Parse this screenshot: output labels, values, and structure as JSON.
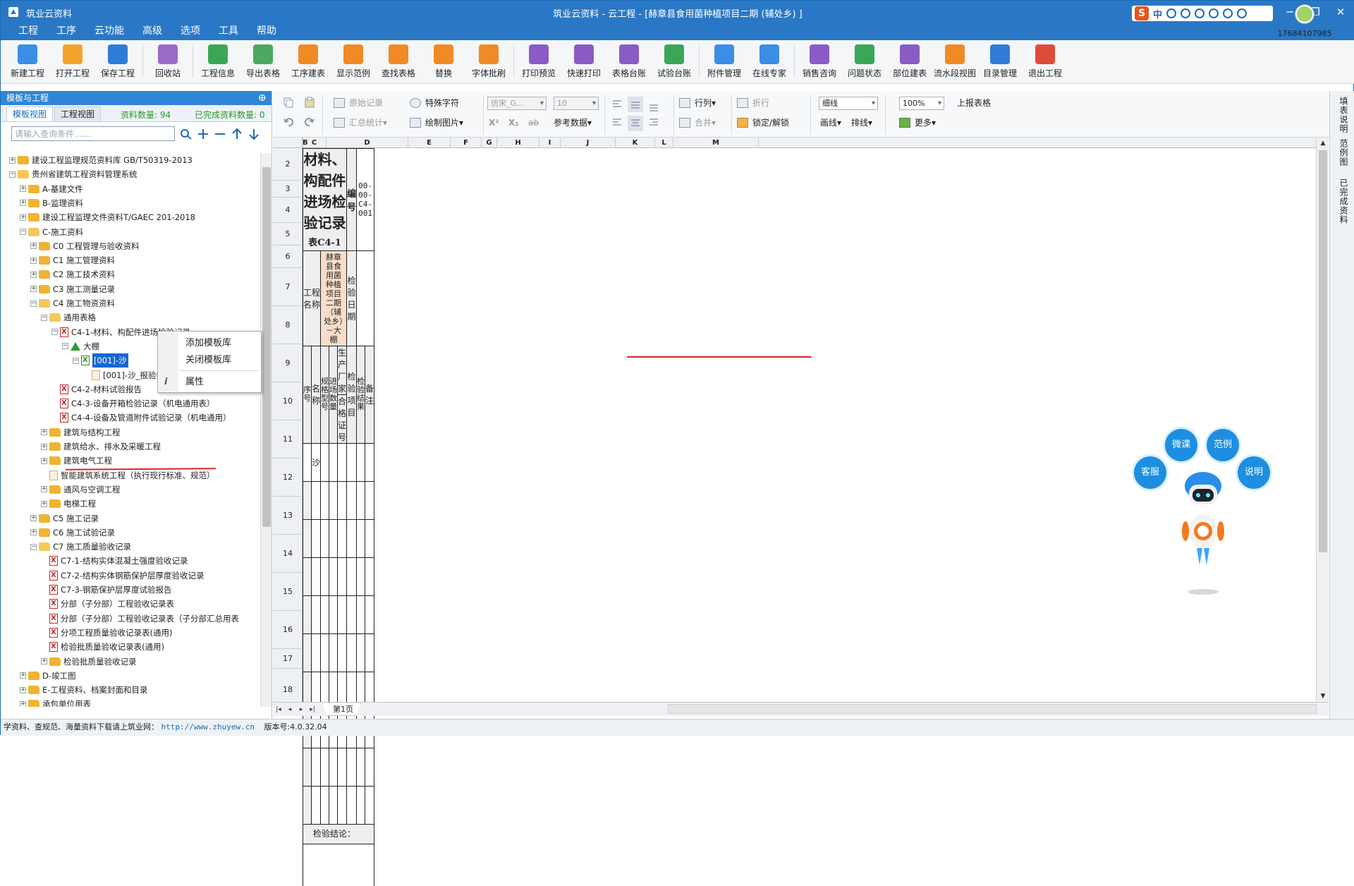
{
  "titlebar": {
    "app_name": "筑业云资料",
    "window_title": "筑业云资料 - 云工程 - [赫章县食用菌种植项目二期 (辅处乡) ]",
    "ime_label": "中",
    "ime_logo": "S",
    "min": "─",
    "max": "❐",
    "close": "✕"
  },
  "menu": [
    "工程",
    "工序",
    "云功能",
    "高级",
    "选项",
    "工具",
    "帮助"
  ],
  "toolbar": {
    "buttons": [
      {
        "label": "新建工程",
        "icon": "new-project-icon",
        "color": "#3a8ee6"
      },
      {
        "label": "打开工程",
        "icon": "open-folder-icon",
        "color": "#f2a42a"
      },
      {
        "label": "保存工程",
        "icon": "save-icon",
        "color": "#2f7cd8"
      },
      {
        "label": "回收站",
        "icon": "recycle-bin-icon",
        "color": "#9b6bc9"
      },
      {
        "label": "工程信息",
        "icon": "info-icon",
        "color": "#3aa757"
      },
      {
        "label": "导出表格",
        "icon": "export-table-icon",
        "color": "#4aa860"
      },
      {
        "label": "工序建表",
        "icon": "layers-icon",
        "color": "#f08a24"
      },
      {
        "label": "显示范例",
        "icon": "example-icon",
        "color": "#f08a24"
      },
      {
        "label": "查找表格",
        "icon": "search-table-icon",
        "color": "#f08a24"
      },
      {
        "label": "替换",
        "icon": "replace-icon",
        "color": "#f08a24"
      },
      {
        "label": "字体批刷",
        "icon": "font-brush-icon",
        "color": "#f08a24"
      },
      {
        "label": "打印预览",
        "icon": "print-preview-icon",
        "color": "#8a5bc6"
      },
      {
        "label": "快速打印",
        "icon": "printer-icon",
        "color": "#8a5bc6"
      },
      {
        "label": "表格台账",
        "icon": "ledger-icon",
        "color": "#8a5bc6"
      },
      {
        "label": "试验台账",
        "icon": "test-ledger-icon",
        "color": "#3aa757"
      },
      {
        "label": "附件管理",
        "icon": "attachment-icon",
        "color": "#3a8ee6"
      },
      {
        "label": "在线专家",
        "icon": "expert-icon",
        "color": "#3a8ee6"
      },
      {
        "label": "销售咨询",
        "icon": "consult-icon",
        "color": "#8a5bc6"
      },
      {
        "label": "问题状态",
        "icon": "question-icon",
        "color": "#3aa757"
      },
      {
        "label": "部位建表",
        "icon": "grid-icon",
        "color": "#8a5bc6"
      },
      {
        "label": "流水段视图",
        "icon": "flow-view-icon",
        "color": "#f08a24"
      },
      {
        "label": "目录管理",
        "icon": "catalog-icon",
        "color": "#2f7cd8"
      },
      {
        "label": "退出工程",
        "icon": "power-icon",
        "color": "#e04a3a"
      }
    ],
    "user_id": "17684107985"
  },
  "left_panel": {
    "header": "模板与工程",
    "pin": "ⴲ",
    "tabs": [
      "模板视图",
      "工程视图"
    ],
    "stat_total": "资料数量: 94",
    "stat_done": "已完成资料数量: 0",
    "search_placeholder": "请输入查询条件……",
    "tree": [
      {
        "text": "建设工程监理规范资料库 GB/T50319-2013",
        "level": 0,
        "exp": "+",
        "icon": "folder"
      },
      {
        "text": "贵州省建筑工程资料管理系统",
        "level": 0,
        "exp": "−",
        "icon": "folder-open"
      },
      {
        "text": "A-基建文件",
        "level": 1,
        "exp": "+",
        "icon": "folder"
      },
      {
        "text": "B-监理资料",
        "level": 1,
        "exp": "+",
        "icon": "folder"
      },
      {
        "text": "建设工程监理文件资料T/GAEC 201-2018",
        "level": 1,
        "exp": "+",
        "icon": "folder"
      },
      {
        "text": "C-施工资料",
        "level": 1,
        "exp": "−",
        "icon": "folder-open"
      },
      {
        "text": "C0 工程管理与验收资料",
        "level": 2,
        "exp": "+",
        "icon": "folder"
      },
      {
        "text": "C1 施工管理资料",
        "level": 2,
        "exp": "+",
        "icon": "folder"
      },
      {
        "text": "C2 施工技术资料",
        "level": 2,
        "exp": "+",
        "icon": "folder"
      },
      {
        "text": "C3 施工测量记录",
        "level": 2,
        "exp": "+",
        "icon": "folder"
      },
      {
        "text": "C4 施工物资资料",
        "level": 2,
        "exp": "−",
        "icon": "folder-open"
      },
      {
        "text": "通用表格",
        "level": 3,
        "exp": "−",
        "icon": "folder-open"
      },
      {
        "text": "C4-1-材料、构配件进场检验记录",
        "level": 4,
        "exp": "−",
        "icon": "xl"
      },
      {
        "text": "大棚",
        "level": 5,
        "exp": "−",
        "icon": "home"
      },
      {
        "text": "[001]-沙",
        "level": 6,
        "exp": "−",
        "icon": "xg",
        "selected": true
      },
      {
        "text": "[001]-沙_报验申请表",
        "level": 7,
        "exp": "",
        "icon": "doc"
      },
      {
        "text": "C4-2-材料试验报告",
        "level": 4,
        "exp": "",
        "icon": "xl"
      },
      {
        "text": "C4-3-设备开箱检验记录（机电通用表）",
        "level": 4,
        "exp": "",
        "icon": "xl"
      },
      {
        "text": "C4-4-设备及管道附件试验记录（机电通用）",
        "level": 4,
        "exp": "",
        "icon": "xl"
      },
      {
        "text": "建筑与结构工程",
        "level": 3,
        "exp": "+",
        "icon": "folder"
      },
      {
        "text": "建筑给水、排水及采暖工程",
        "level": 3,
        "exp": "+",
        "icon": "folder"
      },
      {
        "text": "建筑电气工程",
        "level": 3,
        "exp": "+",
        "icon": "folder"
      },
      {
        "text": "智能建筑系统工程（执行现行标准、规范）",
        "level": 3,
        "exp": "",
        "icon": "doc"
      },
      {
        "text": "通风与空调工程",
        "level": 3,
        "exp": "+",
        "icon": "folder"
      },
      {
        "text": "电梯工程",
        "level": 3,
        "exp": "+",
        "icon": "folder"
      },
      {
        "text": "C5 施工记录",
        "level": 2,
        "exp": "+",
        "icon": "folder"
      },
      {
        "text": "C6 施工试验记录",
        "level": 2,
        "exp": "+",
        "icon": "folder"
      },
      {
        "text": "C7 施工质量验收记录",
        "level": 2,
        "exp": "−",
        "icon": "folder-open"
      },
      {
        "text": "C7-1-结构实体混凝土强度验收记录",
        "level": 3,
        "exp": "",
        "icon": "xl"
      },
      {
        "text": "C7-2-结构实体钢筋保护层厚度验收记录",
        "level": 3,
        "exp": "",
        "icon": "xl"
      },
      {
        "text": "C7-3-钢筋保护层厚度试验报告",
        "level": 3,
        "exp": "",
        "icon": "xl"
      },
      {
        "text": "分部（子分部）工程验收记录表",
        "level": 3,
        "exp": "",
        "icon": "xl"
      },
      {
        "text": "分部（子分部）工程验收记录表（子分部汇总用表",
        "level": 3,
        "exp": "",
        "icon": "xl"
      },
      {
        "text": "分项工程质量验收记录表(通用)",
        "level": 3,
        "exp": "",
        "icon": "xl"
      },
      {
        "text": "检验批质量验收记录表(通用)",
        "level": 3,
        "exp": "",
        "icon": "xl"
      },
      {
        "text": "检验批质量验收记录",
        "level": 3,
        "exp": "+",
        "icon": "folder"
      },
      {
        "text": "D-竣工图",
        "level": 1,
        "exp": "+",
        "icon": "folder"
      },
      {
        "text": "E-工程资料、档案封面和目录",
        "level": 1,
        "exp": "+",
        "icon": "folder"
      },
      {
        "text": "承包单位用表",
        "level": 1,
        "exp": "+",
        "icon": "folder"
      }
    ],
    "context_menu": [
      "添加模板库",
      "关闭模板库",
      "属性"
    ],
    "context_info_icon": "i"
  },
  "ribbon": {
    "original_record": "原始记录",
    "special_char": "特殊字符",
    "summary_stat": "汇总统计",
    "draw_picture": "绘制图片",
    "font_name": "仿宋_G...",
    "font_size": "10",
    "sup": "X²",
    "sub": "X₂",
    "strike": "ab",
    "ref_data": "参考数据",
    "row_col": "行列",
    "merge": "合并",
    "wrap": "折行",
    "lock_unlock": "锁定/解锁",
    "line_style": "细线",
    "draw_line": "画线",
    "row_line": "排线",
    "zoom": "100%",
    "more": "更多",
    "upload_table": "上报表格"
  },
  "sheet": {
    "col_headers": [
      "B",
      "C",
      "D",
      "E",
      "F",
      "G",
      "H",
      "I",
      "J",
      "K",
      "L",
      "M"
    ],
    "row_headers": [
      "2",
      "3",
      "4",
      "5",
      "6",
      "7",
      "8",
      "9",
      "10",
      "11",
      "12",
      "13",
      "14",
      "15",
      "16",
      "17",
      "18"
    ],
    "form": {
      "title": "材料、构配件进场检验记录",
      "table_code": "表C4-1",
      "number_label": "编  号",
      "number_value": "00-00-C4-001",
      "project_name_label": "工程名称",
      "project_name_value": "赫章县食用菌种植项目二期（辅处乡）－大棚",
      "inspect_date_label": "检验日期",
      "col_seq": "序号",
      "col_name": "名  称",
      "col_spec": "规格型号",
      "col_qty": "进场数量",
      "col_maker": "生产厂家",
      "col_cert": "合格证号",
      "col_item": "检验项目",
      "col_result": "检验结果",
      "col_remark": "备  注",
      "first_item": "沙",
      "conclusion_label": "检验结论："
    },
    "sheet_tab": "第1页",
    "nav_first": "|◂",
    "nav_prev": "◂",
    "nav_next": "▸",
    "nav_last": "▸|"
  },
  "right_strip": [
    "填表说明",
    "范例图",
    "已完成资料"
  ],
  "assistant_bubbles": [
    "微课",
    "范例",
    "客服",
    "说明"
  ],
  "status": {
    "text": "学资料、查规范、海量资料下载请上筑业网：",
    "url": "http://www.zhuyew.cn",
    "version": "版本号:4.0.32.04"
  }
}
